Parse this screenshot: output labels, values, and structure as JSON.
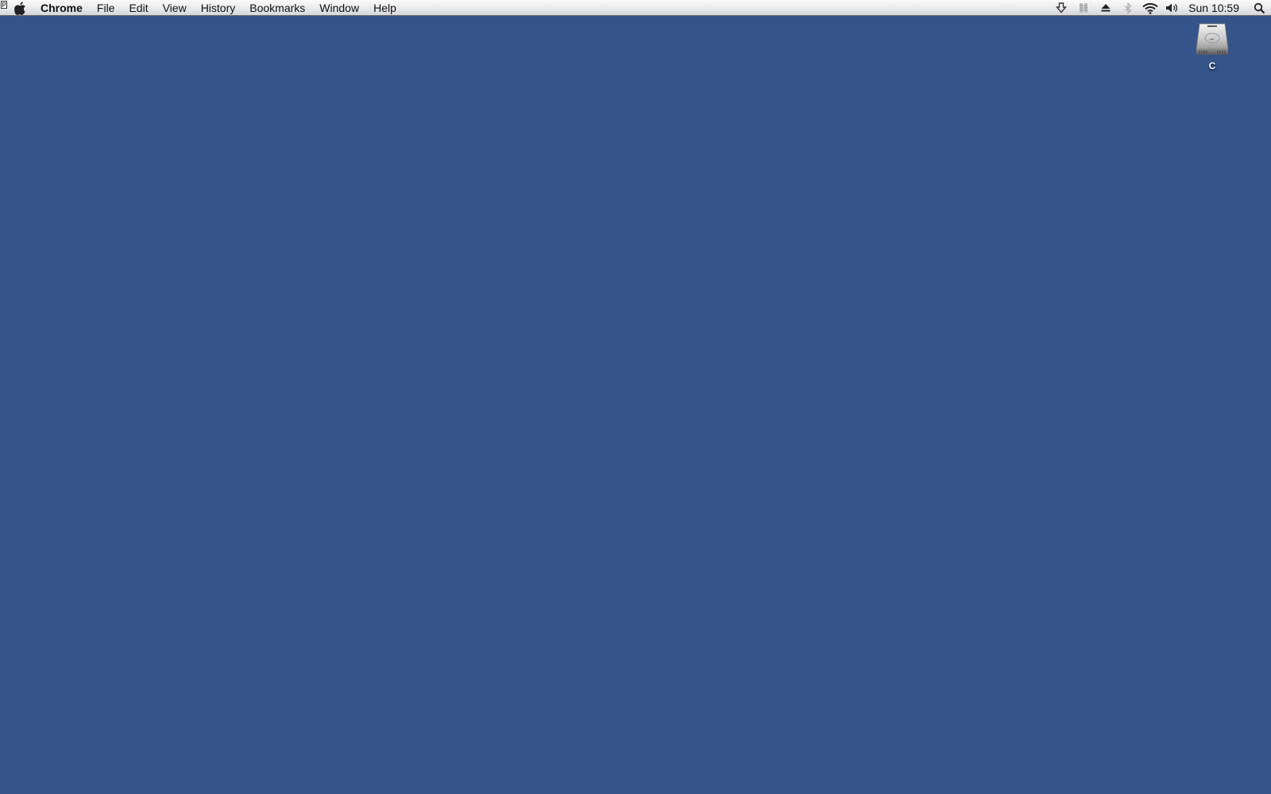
{
  "menubar": {
    "corner_glyph": "P",
    "apple_icon": "apple-logo-icon",
    "app_name": "Chrome",
    "menus": [
      "File",
      "Edit",
      "View",
      "History",
      "Bookmarks",
      "Window",
      "Help"
    ],
    "status_icons": [
      "download-arrow-icon",
      "menu-extra-icon",
      "eject-icon",
      "bluetooth-icon",
      "wifi-icon",
      "volume-icon"
    ],
    "clock": "Sun 10:59",
    "spotlight_icon": "spotlight-search-icon"
  },
  "desktop": {
    "background_color": "#34548a",
    "icons": [
      {
        "label": "C",
        "icon": "hard-drive-icon"
      }
    ]
  }
}
